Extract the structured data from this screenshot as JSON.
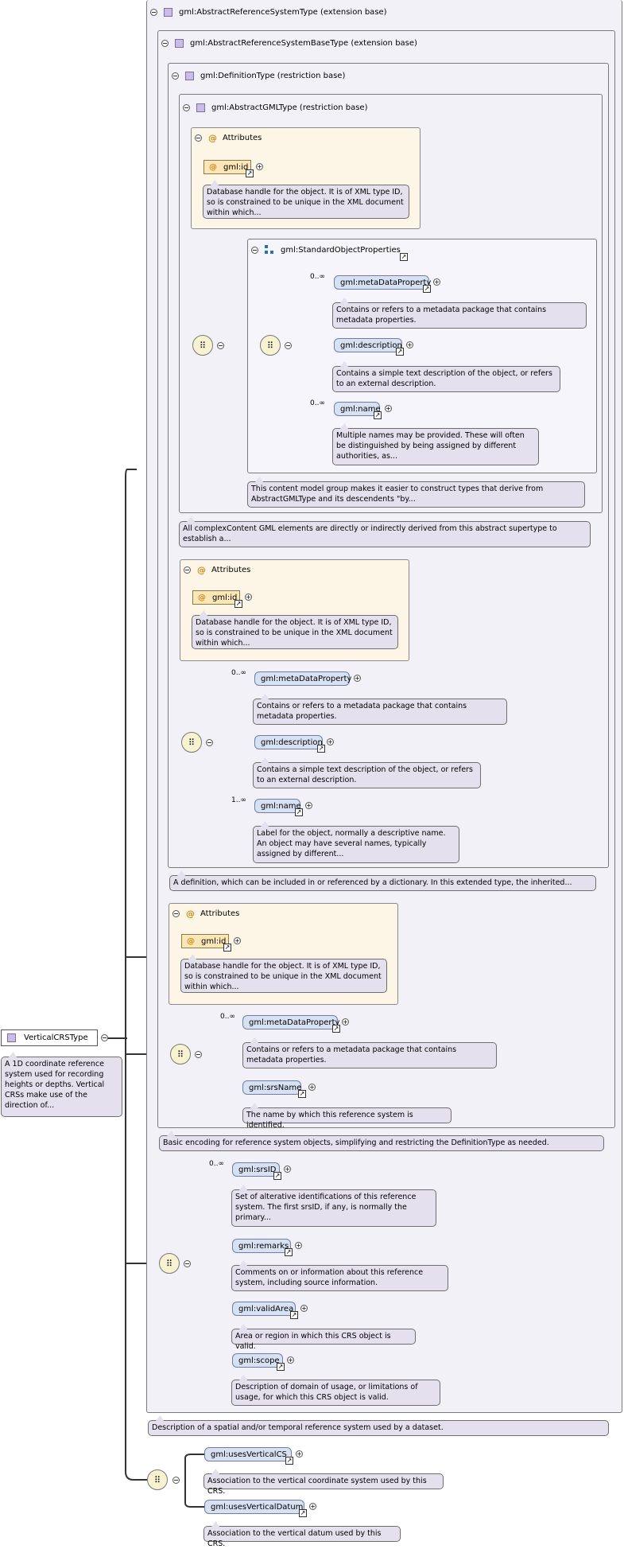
{
  "root": {
    "name": "VerticalCRSType",
    "desc": "A 1D coordinate reference system used for recording heights or depths. Vertical CRSs make use of the direction of..."
  },
  "levels": {
    "l1": {
      "title": "gml:AbstractReferenceSystemType (extension base)",
      "desc": "Description of a spatial and/or temporal reference system used by a dataset."
    },
    "l2": {
      "title": "gml:AbstractReferenceSystemBaseType (extension base)",
      "desc": "Basic encoding for reference system objects, simplifying and restricting the DefinitionType as needed."
    },
    "l3": {
      "title": "gml:DefinitionType (restriction base)",
      "desc": "A definition, which can be included in or referenced by a dictionary. In this extended type, the inherited..."
    },
    "l4": {
      "title": "gml:AbstractGMLType (restriction base)",
      "desc": "All complexContent GML elements are directly or indirectly derived from this abstract supertype to establish a..."
    }
  },
  "attributes_label": "Attributes",
  "attr_id": {
    "name": "gml:id",
    "desc": "Database handle for the object. It is of XML type ID, so is constrained to be unique in the XML document within which..."
  },
  "std_group": {
    "title": "gml:StandardObjectProperties",
    "desc": "This content model group makes it easier to construct types that derive from AbstractGMLType and its descendents \"by...",
    "metaDataProperty": {
      "name": "gml:metaDataProperty",
      "card": "0..∞",
      "desc": "Contains or refers to a metadata package that contains metadata properties."
    },
    "description": {
      "name": "gml:description",
      "desc": "Contains a simple text description of the object, or refers to an external description."
    },
    "name": {
      "name": "gml:name",
      "card": "0..∞",
      "desc": "Multiple names may be provided. These will often be distinguished by being assigned by different authorities, as..."
    }
  },
  "def_seq": {
    "metaDataProperty": {
      "name": "gml:metaDataProperty",
      "card": "0..∞",
      "desc": "Contains or refers to a metadata package that contains metadata properties."
    },
    "description": {
      "name": "gml:description",
      "desc": "Contains a simple text description of the object, or refers to an external description."
    },
    "name": {
      "name": "gml:name",
      "card": "1..∞",
      "desc": "Label for the object, normally a descriptive name. An object may have several names, typically assigned by different..."
    }
  },
  "base_seq": {
    "metaDataProperty": {
      "name": "gml:metaDataProperty",
      "card": "0..∞",
      "desc": "Contains or refers to a metadata package that contains metadata properties."
    },
    "srsName": {
      "name": "gml:srsName",
      "desc": "The name by which this reference system is identified."
    }
  },
  "ars_seq": {
    "srsID": {
      "name": "gml:srsID",
      "card": "0..∞",
      "desc": "Set of alterative identifications of this reference system. The first srsID, if any, is normally the primary..."
    },
    "remarks": {
      "name": "gml:remarks",
      "desc": "Comments on or information about this reference system, including source information."
    },
    "validArea": {
      "name": "gml:validArea",
      "desc": "Area or region in which this CRS object is valid."
    },
    "scope": {
      "name": "gml:scope",
      "desc": "Description of domain of usage, or limitations of usage, for which this CRS object is valid."
    }
  },
  "crs_seq": {
    "usesVerticalCS": {
      "name": "gml:usesVerticalCS",
      "desc": "Association to the vertical coordinate system used by this CRS."
    },
    "usesVerticalDatum": {
      "name": "gml:usesVerticalDatum",
      "desc": "Association to the vertical datum used by this CRS."
    }
  },
  "icons": {
    "sequence": "sequence-icon",
    "attribute": "at-sign-icon",
    "type": "complex-type-icon",
    "group": "model-group-icon",
    "link": "link-arrow-icon",
    "expand": "plus-icon",
    "collapse": "minus-icon"
  }
}
